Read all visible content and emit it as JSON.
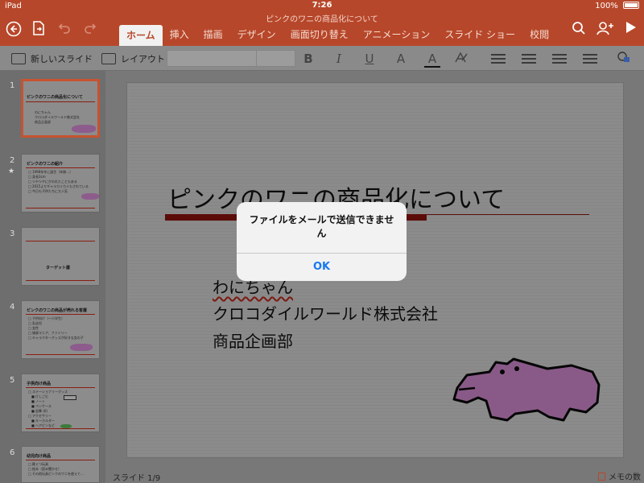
{
  "status_bar": {
    "device": "iPad",
    "time": "7:26",
    "battery": "100%"
  },
  "document": {
    "title": "ピンクのワニの商品化について"
  },
  "tabs": [
    {
      "label": "ホーム",
      "active": true
    },
    {
      "label": "挿入"
    },
    {
      "label": "描画"
    },
    {
      "label": "デザイン"
    },
    {
      "label": "画面切り替え"
    },
    {
      "label": "アニメーション"
    },
    {
      "label": "スライド ショー"
    },
    {
      "label": "校閲"
    }
  ],
  "ribbon": {
    "new_slide": "新しいスライド",
    "layout": "レイアウト",
    "bold": "B",
    "italic": "I",
    "underline": "U",
    "font_color_glyph": "A",
    "font_size_glyph": "A"
  },
  "thumbnails": [
    {
      "num": "1",
      "title": "ピンクのワニの商品化について",
      "items": [
        "わにちゃん",
        "クロコダイルワールド株式会社",
        "商品企画部"
      ]
    },
    {
      "num": "2",
      "title": "ピンクのワニの紹介",
      "items": [
        "□ 1998年冬に誕生（年齢…）",
        "□ 身長3cm",
        "□ ツヤツヤにかわれたこともある",
        "□ 2015よりギャラカミカミもされている",
        "□ 今日も子供たちに大人気"
      ]
    },
    {
      "num": "3",
      "title": "ターゲット層"
    },
    {
      "num": "4",
      "title": "ピンクのワニの商品が売れる客層",
      "items": [
        "□ 子供向け（～小学生）",
        "□ 乳幼児",
        "□ 女性",
        "□ 雑貨マニア、ファミリー",
        "□ キャラクターグッズが好きな女の子"
      ]
    },
    {
      "num": "5",
      "title": "子供向け商品",
      "items": [
        "□ ステーショナリーグッズ",
        "　■ けしごむ",
        "　■ ノート",
        "　■ ペンケース",
        "　■ 鉛筆 (6)",
        "□ アクセサリー",
        "　■ キーホルダー",
        "　■ ヘアピンなど"
      ]
    },
    {
      "num": "6",
      "title": "幼児向け商品",
      "items": [
        "□ 靴ぐつ玩具",
        "□ 絵本（読み聞かせ）",
        "□ その他玩具ピンクのワニを使えて…"
      ]
    }
  ],
  "slide": {
    "title": "ピンクのワニの商品化について",
    "subtitle_lines": [
      "わにちゃん",
      "クロコダイルワールド株式会社",
      "商品企画部"
    ]
  },
  "footer": {
    "slide_indicator": "スライド 1/9",
    "notes": "メモの数"
  },
  "alert": {
    "message": "ファイルをメールで送信できません",
    "ok": "OK"
  },
  "colors": {
    "brand": "#b7472a",
    "alert_button": "#1878f0",
    "accent_line": "#8b1d10"
  }
}
